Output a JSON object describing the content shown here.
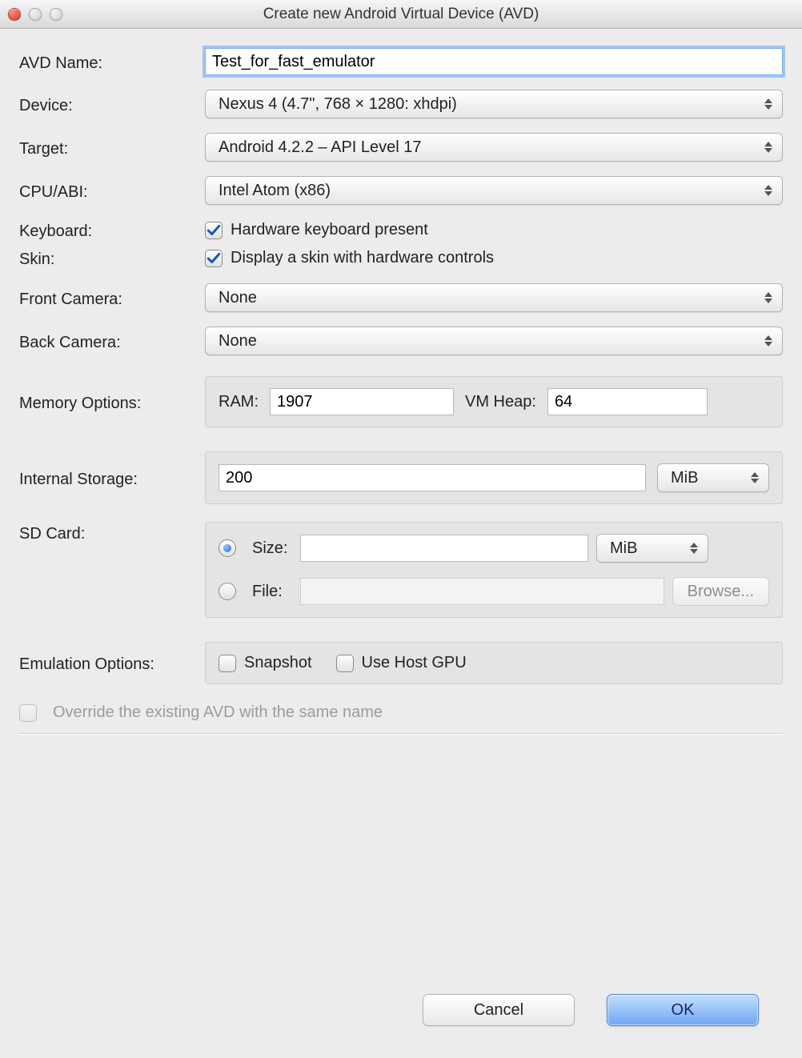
{
  "window": {
    "title": "Create new Android Virtual Device (AVD)"
  },
  "labels": {
    "avd_name": "AVD Name:",
    "device": "Device:",
    "target": "Target:",
    "cpu_abi": "CPU/ABI:",
    "keyboard": "Keyboard:",
    "skin": "Skin:",
    "front_camera": "Front Camera:",
    "back_camera": "Back Camera:",
    "memory_options": "Memory Options:",
    "internal_storage": "Internal Storage:",
    "sd_card": "SD Card:",
    "emulation_options": "Emulation Options:"
  },
  "fields": {
    "avd_name": "Test_for_fast_emulator",
    "device": "Nexus 4 (4.7\", 768 × 1280: xhdpi)",
    "target": "Android 4.2.2 – API Level 17",
    "cpu_abi": "Intel Atom (x86)",
    "keyboard_label": "Hardware keyboard present",
    "skin_label": "Display a skin with hardware controls",
    "front_camera": "None",
    "back_camera": "None",
    "ram_label": "RAM:",
    "ram_value": "1907",
    "heap_label": "VM Heap:",
    "heap_value": "64",
    "internal_storage_value": "200",
    "storage_unit": "MiB",
    "sd_size_label": "Size:",
    "sd_size_value": "",
    "sd_size_unit": "MiB",
    "sd_file_label": "File:",
    "sd_file_value": "",
    "browse": "Browse...",
    "snapshot": "Snapshot",
    "use_host_gpu": "Use Host GPU",
    "override": "Override the existing AVD with the same name"
  },
  "buttons": {
    "cancel": "Cancel",
    "ok": "OK"
  }
}
